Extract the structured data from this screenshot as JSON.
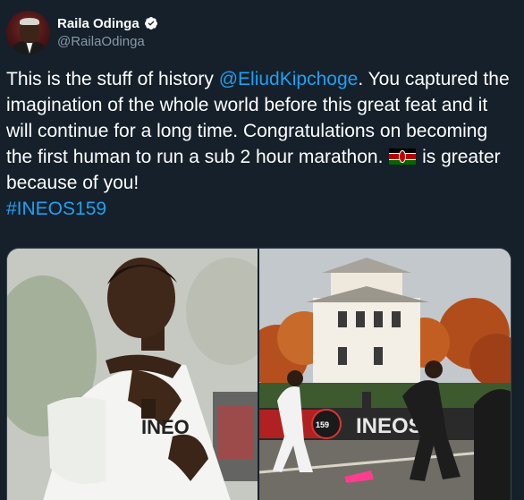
{
  "tweet": {
    "display_name": "Raila Odinga",
    "handle": "@RailaOdinga",
    "text_part1": "This is the stuff of history ",
    "mention": "@EliudKipchoge",
    "text_part2": ". You captured the imagination of the whole world before this great feat and it will continue for a long time. Congratulations on becoming the first human to run a sub 2 hour marathon. ",
    "flag_emoji": "kenya-flag",
    "text_part3": " is greater because of you!",
    "hashtag": "#INEOS159"
  },
  "media": {
    "left_photo": {
      "jersey_text": "INEO",
      "kind": "runner-closeup"
    },
    "right_photo": {
      "banner_text": "INEOS",
      "badge_text": "INEOS 159",
      "kind": "runners-on-course"
    }
  },
  "colors": {
    "background": "#15202b",
    "link": "#1da1f2",
    "secondary_text": "#8899a6",
    "verified_badge": "#ffffff"
  }
}
